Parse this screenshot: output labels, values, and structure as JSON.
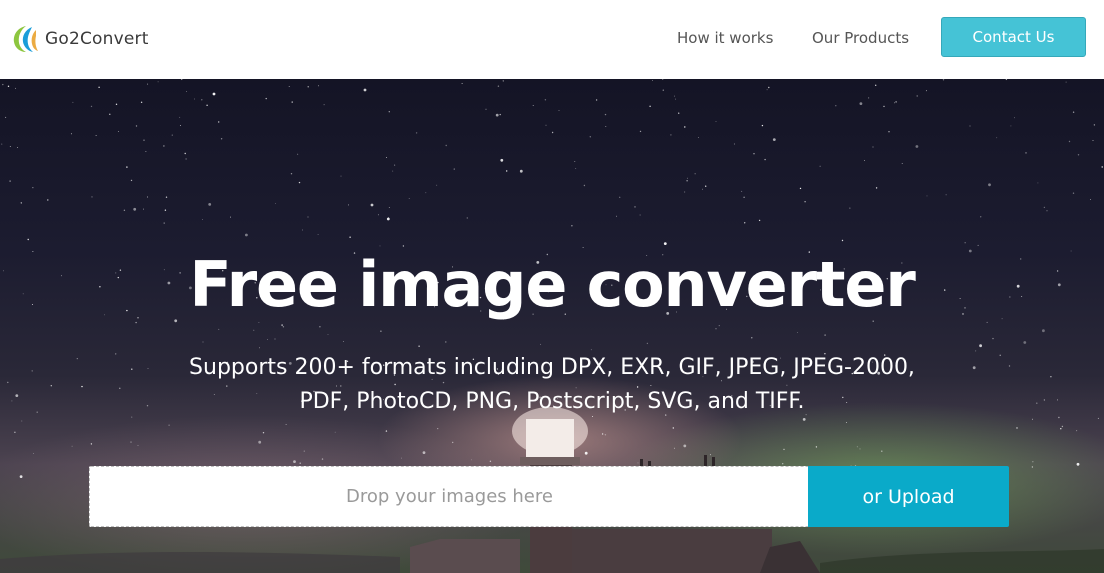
{
  "header": {
    "logo_text": "Go2Convert",
    "nav": [
      {
        "label": "How it works"
      },
      {
        "label": "Our Products"
      }
    ],
    "contact_label": "Contact Us"
  },
  "hero": {
    "title": "Free image converter",
    "subtitle_line1": "Supports 200+ formats including DPX, EXR, GIF, JPEG, JPEG-2000,",
    "subtitle_line2": "PDF, PhotoCD, PNG, Postscript, SVG, and TIFF.",
    "drop_placeholder": "Drop your images here",
    "upload_label": "or Upload"
  },
  "colors": {
    "accent": "#45c3d6",
    "upload": "#0aaac9"
  },
  "icons": {
    "logo": "go2convert-logo-icon"
  }
}
